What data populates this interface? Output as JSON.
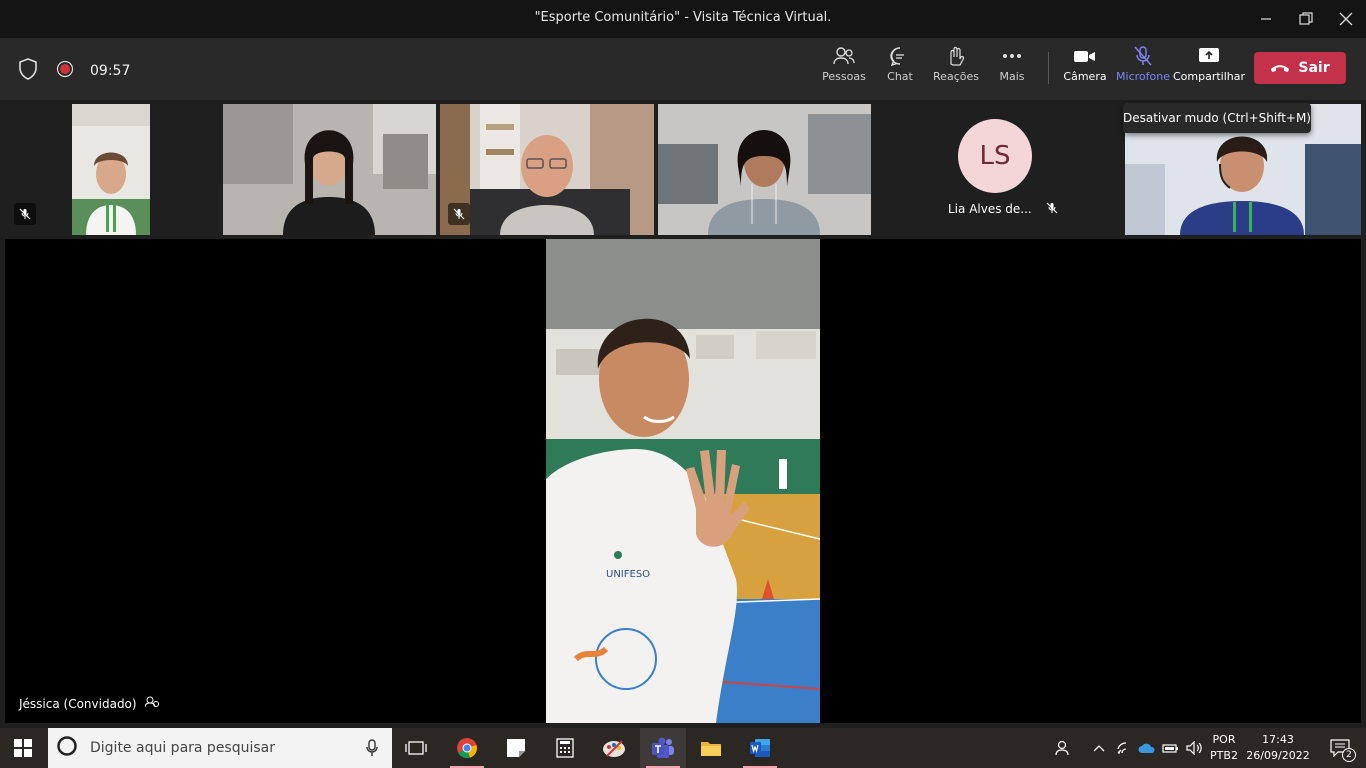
{
  "window": {
    "title": "\"Esporte Comunitário\" - Visita Técnica Virtual."
  },
  "toolbar": {
    "timer": "09:57",
    "people_label": "Pessoas",
    "chat_label": "Chat",
    "reactions_label": "Reações",
    "more_label": "Mais",
    "camera_label": "Câmera",
    "mic_label": "Microfone",
    "share_label": "Compartilhar",
    "leave_label": "Sair"
  },
  "tooltip": {
    "text": "Desativar mudo (Ctrl+Shift+M)"
  },
  "participants": [
    {
      "initials": "LS",
      "name": "Lia Alves de..."
    }
  ],
  "main_stage": {
    "name": "Jéssica (Convidado)"
  },
  "taskbar": {
    "search_placeholder": "Digite aqui para pesquisar",
    "lang_line1": "POR",
    "lang_line2": "PTB2",
    "time": "17:43",
    "date": "26/09/2022",
    "notification_count": "2"
  },
  "colors": {
    "accent_mic": "#7f85f5",
    "leave_button": "#c4314b",
    "avatar_bg": "#f4d5d8",
    "taskbar_running": "#f6a5b0"
  }
}
